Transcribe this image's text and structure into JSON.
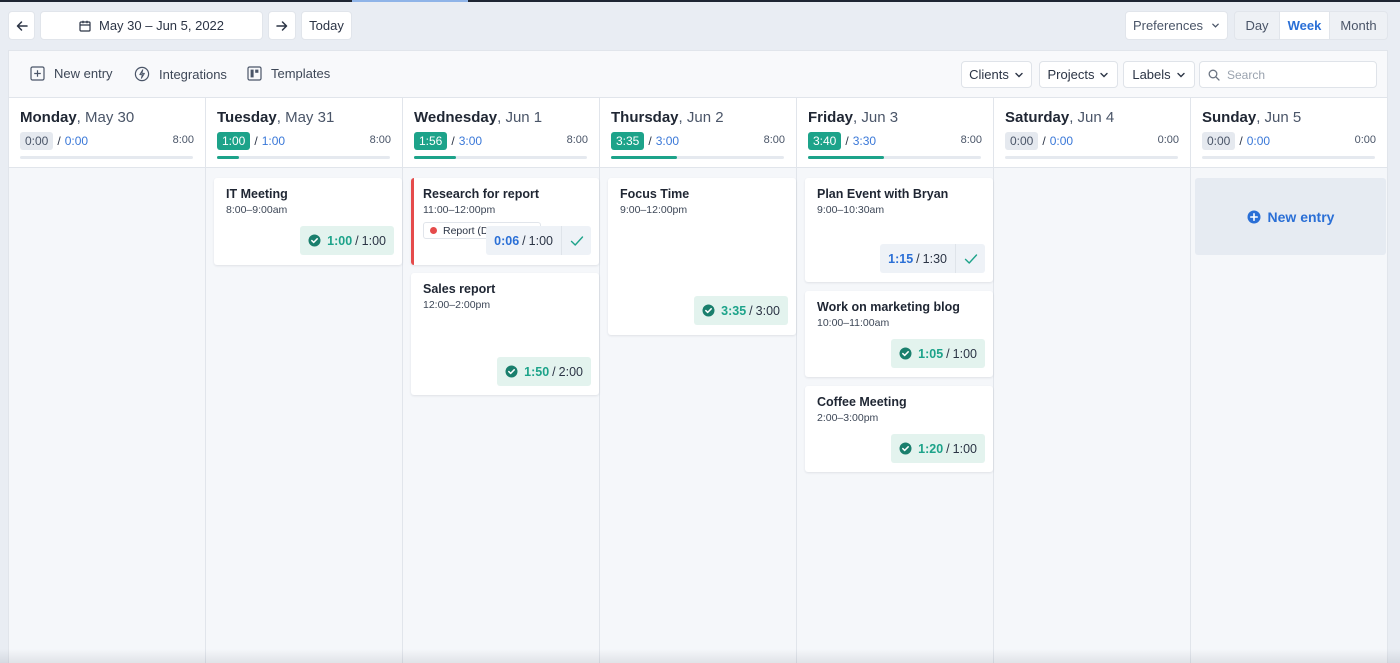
{
  "nav": {
    "date_range": "May 30 – Jun 5, 2022",
    "today_label": "Today",
    "preferences_label": "Preferences",
    "views": [
      "Day",
      "Week",
      "Month"
    ],
    "active_view": "Week"
  },
  "toolbar": {
    "new_entry_label": "New entry",
    "integrations_label": "Integrations",
    "templates_label": "Templates",
    "clients_label": "Clients",
    "projects_label": "Projects",
    "labels_label": "Labels",
    "search_placeholder": "Search"
  },
  "colors": {
    "accent_green": "#1da38a",
    "accent_blue": "#2a6fd6",
    "flag_red": "#e54b4b"
  },
  "days": [
    {
      "weekday": "Monday",
      "date": "May 30",
      "tracked": "0:00",
      "planned": "0:00",
      "capacity": "8:00",
      "progress": 0,
      "entries": []
    },
    {
      "weekday": "Tuesday",
      "date": "May 31",
      "tracked": "1:00",
      "planned": "1:00",
      "capacity": "8:00",
      "progress": 0.13,
      "entries": [
        {
          "title": "IT Meeting",
          "time": "8:00–9:00am",
          "status": "done",
          "tracked": "1:00",
          "planned": "1:00"
        }
      ]
    },
    {
      "weekday": "Wednesday",
      "date": "Jun 1",
      "tracked": "1:56",
      "planned": "3:00",
      "capacity": "8:00",
      "progress": 0.24,
      "entries": [
        {
          "title": "Research for report",
          "time": "11:00–12:00pm",
          "status": "open",
          "tracked": "0:06",
          "planned": "1:00",
          "tag": "Report (D",
          "flagged": true
        },
        {
          "title": "Sales report",
          "time": "12:00–2:00pm",
          "status": "done",
          "tracked": "1:50",
          "planned": "2:00"
        }
      ]
    },
    {
      "weekday": "Thursday",
      "date": "Jun 2",
      "tracked": "3:35",
      "planned": "3:00",
      "capacity": "8:00",
      "progress": 0.38,
      "entries": [
        {
          "title": "Focus Time",
          "time": "9:00–12:00pm",
          "status": "done",
          "tracked": "3:35",
          "planned": "3:00"
        }
      ]
    },
    {
      "weekday": "Friday",
      "date": "Jun 3",
      "tracked": "3:40",
      "planned": "3:30",
      "capacity": "8:00",
      "progress": 0.44,
      "entries": [
        {
          "title": "Plan Event with Bryan",
          "time": "9:00–10:30am",
          "status": "open",
          "tracked": "1:15",
          "planned": "1:30"
        },
        {
          "title": "Work on marketing blog",
          "time": "10:00–11:00am",
          "status": "done",
          "tracked": "1:05",
          "planned": "1:00"
        },
        {
          "title": "Coffee Meeting",
          "time": "2:00–3:00pm",
          "status": "done",
          "tracked": "1:20",
          "planned": "1:00"
        }
      ]
    },
    {
      "weekday": "Saturday",
      "date": "Jun 4",
      "tracked": "0:00",
      "planned": "0:00",
      "capacity": "0:00",
      "progress": 0,
      "entries": []
    },
    {
      "weekday": "Sunday",
      "date": "Jun 5",
      "tracked": "0:00",
      "planned": "0:00",
      "capacity": "0:00",
      "progress": 0,
      "entries": [],
      "new_entry_label": "New entry"
    }
  ]
}
